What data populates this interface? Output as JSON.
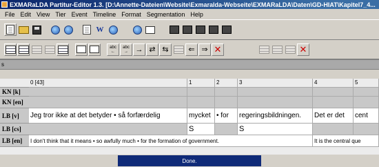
{
  "window": {
    "title": "EXMARaLDA Partitur-Editor 1.3. [D:\\Annette-Dateien\\Website\\Exmaralda-Webseite\\EXMARaLDA\\Daten\\GD-HIAT\\Kapitel7_4..."
  },
  "menu": [
    "File",
    "Edit",
    "View",
    "Tier",
    "Event",
    "Timeline",
    "Format",
    "Segmentation",
    "Help"
  ],
  "infobar": {
    "text": "s"
  },
  "partitur": {
    "header": {
      "label": "",
      "cells": [
        "0 [43]",
        "1",
        "2",
        "3",
        "4",
        "5"
      ]
    },
    "rows": [
      {
        "label": "KN [k]",
        "cells": [
          "",
          "",
          "",
          "",
          "",
          ""
        ]
      },
      {
        "label": "KN [en]",
        "cells": [
          "",
          "",
          "",
          "",
          "",
          ""
        ]
      },
      {
        "label": "LB [v]",
        "cells": [
          "Jeg tror ikke at det betyder • så forfærdelig",
          "mycket",
          "• for",
          "regeringsbildningen.",
          "Det er det",
          "cent"
        ]
      },
      {
        "label": "LB [cs]",
        "cells": [
          "",
          "S",
          "",
          "S",
          "",
          ""
        ]
      },
      {
        "label": "LB [en]",
        "cells": [
          "I don't think that it means • so awfully much • for the formation of government.",
          "It is the central que"
        ]
      }
    ]
  },
  "status": {
    "text": "Done."
  }
}
